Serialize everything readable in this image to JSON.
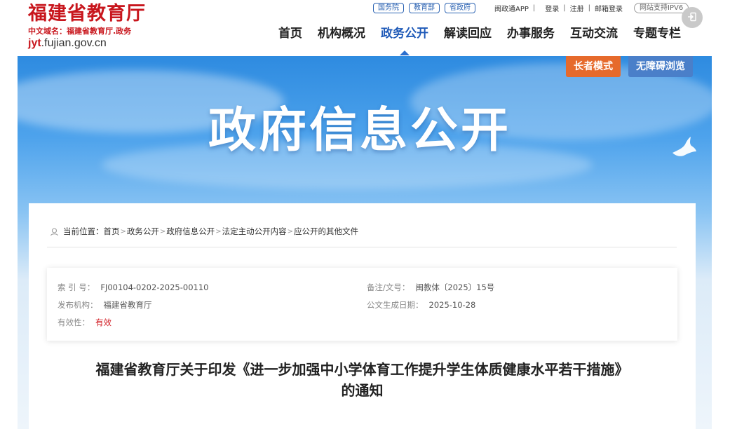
{
  "site": {
    "name": "福建省教育厅",
    "domain_line": "中文域名：福建省教育厅.政务",
    "url_highlight": "jyt",
    "url_rest": ".fujian.gov.cn"
  },
  "toplinks": {
    "pills": [
      "国务院",
      "教育部",
      "省政府"
    ],
    "app": "闽政通APP",
    "login": "登录",
    "register": "注册",
    "mail": "邮箱登录",
    "ipv6": "网站支持IPV6"
  },
  "nav": {
    "items": [
      "首页",
      "机构概况",
      "政务公开",
      "解读回应",
      "办事服务",
      "互动交流",
      "专题专栏"
    ],
    "active": "政务公开"
  },
  "banner": {
    "title": "政府信息公开",
    "elder_mode": "长者模式",
    "accessible_mode": "无障碍浏览"
  },
  "breadcrumb": {
    "prefix": "当前位置：",
    "items": [
      "首页",
      "政务公开",
      "政府信息公开",
      "法定主动公开内容",
      "应公开的其他文件"
    ]
  },
  "meta": {
    "index_label": "索 引 号：",
    "index_value": "FJ00104-0202-2025-00110",
    "docno_label": "备注/文号：",
    "docno_value": "闽教体〔2025〕15号",
    "publisher_label": "发布机构：",
    "publisher_value": "福建省教育厅",
    "date_label": "公文生成日期：",
    "date_value": "2025-10-28",
    "validity_label": "有效性：",
    "validity_value": "有效"
  },
  "document": {
    "title_line1": "福建省教育厅关于印发《进一步加强中小学体育工作提升学生体质健康水平若干措施》",
    "title_line2": "的通知"
  },
  "colors": {
    "brand_red": "#c8161d",
    "nav_active": "#1f5ab8",
    "elder_btn": "#e66a2c",
    "access_btn": "#4a7fc9"
  }
}
